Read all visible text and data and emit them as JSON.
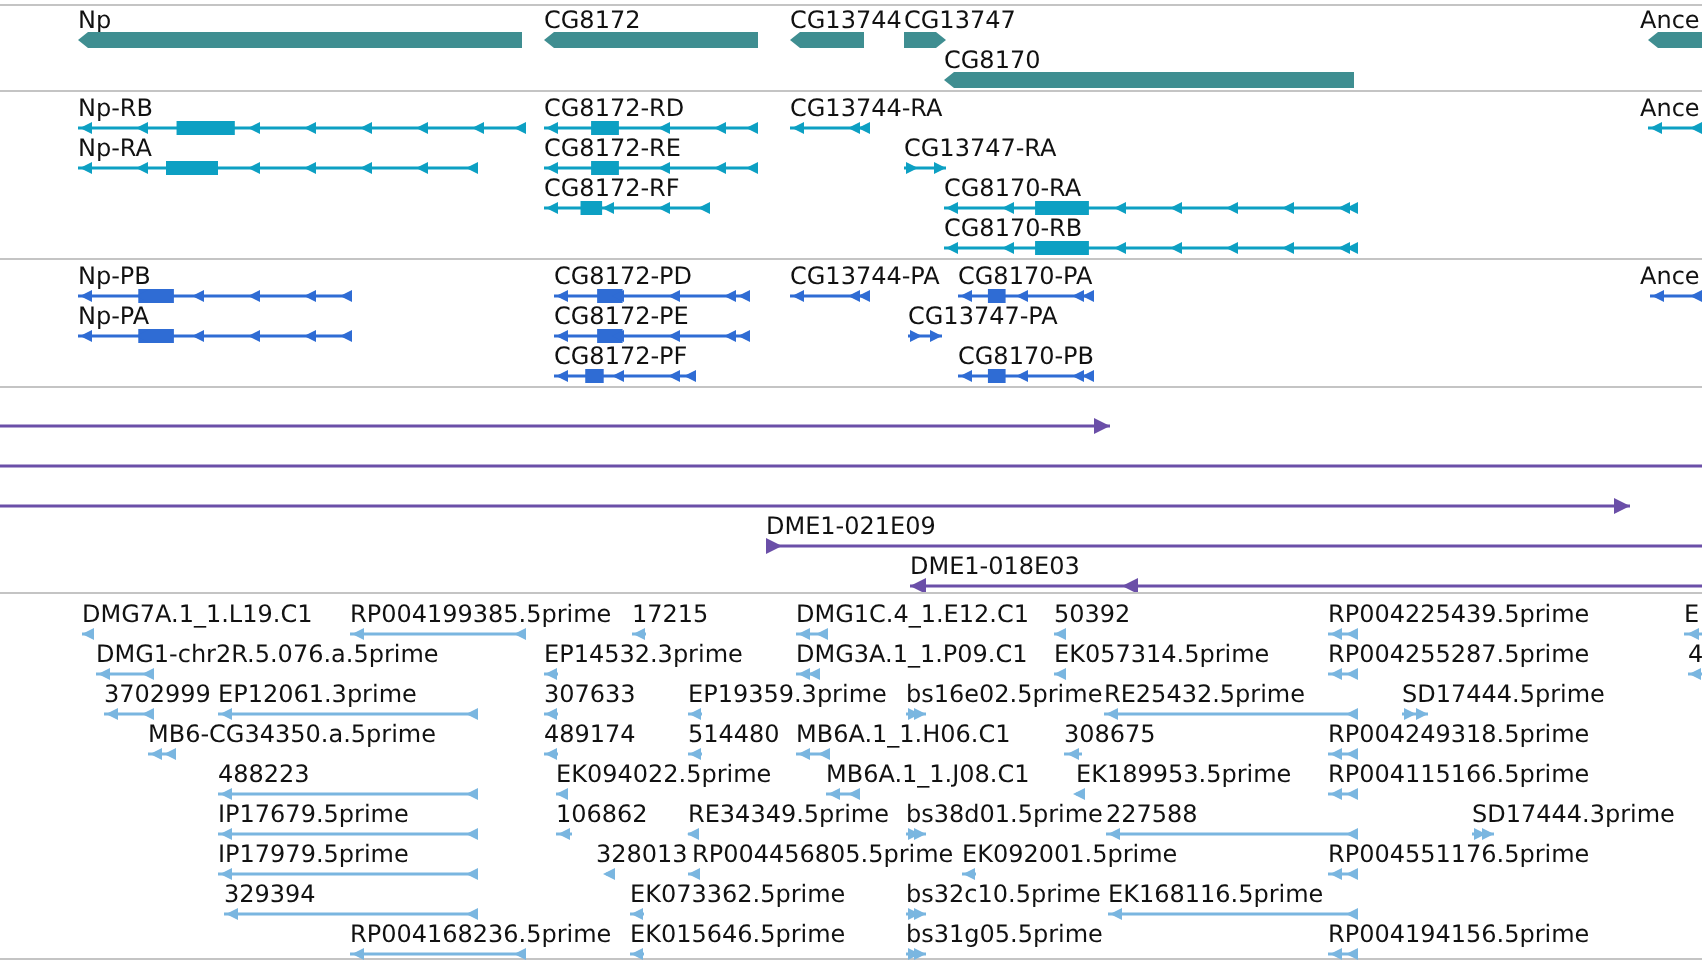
{
  "tracks": [
    {
      "kind": "gene",
      "features": [
        {
          "label": "Np",
          "forward": false
        },
        {
          "label": "CG8172",
          "forward": false
        },
        {
          "label": "CG13744",
          "forward": false
        },
        {
          "label": "CG13747",
          "forward": true
        },
        {
          "label": "CG8170",
          "forward": false
        },
        {
          "label": "Ance",
          "forward": false
        }
      ]
    },
    {
      "kind": "transcript",
      "features": [
        {
          "label": "Np-RB",
          "forward": false
        },
        {
          "label": "Np-RA",
          "forward": false
        },
        {
          "label": "CG8172-RD",
          "forward": false
        },
        {
          "label": "CG8172-RE",
          "forward": false
        },
        {
          "label": "CG8172-RF",
          "forward": false
        },
        {
          "label": "CG13744-RA",
          "forward": false
        },
        {
          "label": "CG13747-RA",
          "forward": true
        },
        {
          "label": "CG8170-RA",
          "forward": false
        },
        {
          "label": "CG8170-RB",
          "forward": false
        },
        {
          "label": "Ance",
          "forward": false
        }
      ]
    },
    {
      "kind": "protein",
      "features": [
        {
          "label": "Np-PB",
          "forward": false
        },
        {
          "label": "Np-PA",
          "forward": false
        },
        {
          "label": "CG8172-PD",
          "forward": false
        },
        {
          "label": "CG8172-PE",
          "forward": false
        },
        {
          "label": "CG8172-PF",
          "forward": false
        },
        {
          "label": "CG13744-PA",
          "forward": false
        },
        {
          "label": "CG8170-PA",
          "forward": false
        },
        {
          "label": "CG13747-PA",
          "forward": true
        },
        {
          "label": "CG8170-PB",
          "forward": false
        },
        {
          "label": "Ance",
          "forward": false
        }
      ]
    },
    {
      "kind": "clone",
      "features": [
        {
          "forward": true
        },
        {
          "kind": "line"
        },
        {
          "forward": true
        },
        {
          "label": "DME1-021E09",
          "forward": true
        },
        {
          "label": "DME1-018E03",
          "forward": false
        }
      ]
    },
    {
      "kind": "est",
      "features": [
        {
          "label": "DMG7A.1_1.L19.C1",
          "forward": false
        },
        {
          "label": "RP004199385.5prime",
          "forward": false
        },
        {
          "label": "17215",
          "forward": false
        },
        {
          "label": "DMG1C.4_1.E12.C1",
          "forward": false
        },
        {
          "label": "50392",
          "forward": false
        },
        {
          "label": "RP004225439.5prime",
          "forward": false
        },
        {
          "label": "E",
          "forward": false
        },
        {
          "label": "DMG1-chr2R.5.076.a.5prime",
          "forward": false
        },
        {
          "label": "EP14532.3prime",
          "forward": false
        },
        {
          "label": "DMG3A.1_1.P09.C1",
          "forward": false
        },
        {
          "label": "EK057314.5prime",
          "forward": false
        },
        {
          "label": "RP004255287.5prime",
          "forward": false
        },
        {
          "label": "4",
          "forward": false
        },
        {
          "label": "3702999",
          "forward": false
        },
        {
          "label": "EP12061.3prime",
          "forward": false
        },
        {
          "label": "307633",
          "forward": false
        },
        {
          "label": "EP19359.3prime",
          "forward": false
        },
        {
          "label": "bs16e02.5prime",
          "forward": true
        },
        {
          "label": "RE25432.5prime",
          "forward": false
        },
        {
          "label": "SD17444.5prime",
          "forward": true
        },
        {
          "label": "MB6-CG34350.a.5prime",
          "forward": false
        },
        {
          "label": "489174",
          "forward": false
        },
        {
          "label": "514480",
          "forward": false
        },
        {
          "label": "MB6A.1_1.H06.C1",
          "forward": false
        },
        {
          "label": "308675",
          "forward": false
        },
        {
          "label": "RP004249318.5prime",
          "forward": false
        },
        {
          "label": "488223",
          "forward": false
        },
        {
          "label": "EK094022.5prime",
          "forward": false
        },
        {
          "label": "MB6A.1_1.J08.C1",
          "forward": false
        },
        {
          "label": "EK189953.5prime",
          "forward": false
        },
        {
          "label": "RP004115166.5prime",
          "forward": false
        },
        {
          "label": "IP17679.5prime",
          "forward": false
        },
        {
          "label": "106862",
          "forward": false
        },
        {
          "label": "RE34349.5prime",
          "forward": false
        },
        {
          "label": "bs38d01.5prime",
          "forward": true
        },
        {
          "label": "227588",
          "forward": false
        },
        {
          "label": "SD17444.3prime",
          "forward": true
        },
        {
          "label": "IP17979.5prime",
          "forward": false
        },
        {
          "label": "328013",
          "forward": false
        },
        {
          "label": "RP004456805.5prime",
          "forward": false
        },
        {
          "label": "EK092001.5prime",
          "forward": false
        },
        {
          "label": "RP004551176.5prime",
          "forward": false
        },
        {
          "label": "329394",
          "forward": false
        },
        {
          "label": "EK073362.5prime",
          "forward": false
        },
        {
          "label": "bs32c10.5prime",
          "forward": true
        },
        {
          "label": "EK168116.5prime",
          "forward": false
        },
        {
          "label": "RP004168236.5prime",
          "forward": false
        },
        {
          "label": "EK015646.5prime",
          "forward": false
        },
        {
          "label": "bs31g05.5prime",
          "forward": true
        },
        {
          "label": "RP004194156.5prime",
          "forward": false
        }
      ]
    }
  ]
}
